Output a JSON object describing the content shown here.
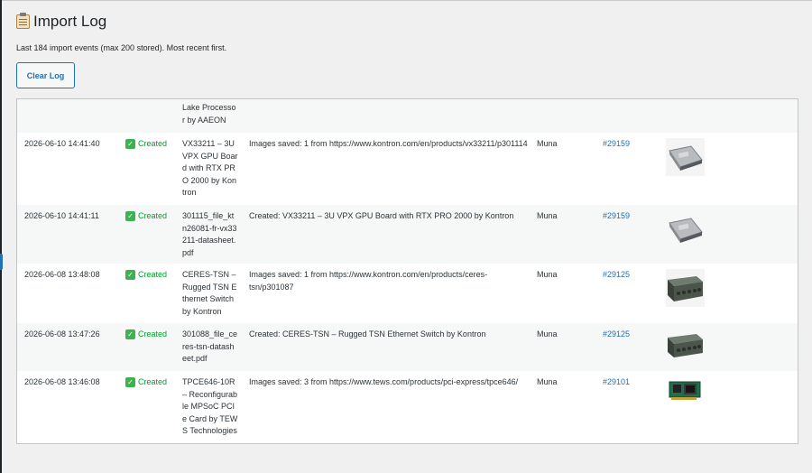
{
  "page": {
    "title": "Import Log",
    "description": "Last 184 import events (max 200 stored). Most recent first.",
    "clear_label": "Clear Log"
  },
  "rows": [
    {
      "date": "",
      "status": "",
      "file": "Lake Processor by AAEON",
      "message": "",
      "user": "",
      "post": "",
      "thumb": ""
    },
    {
      "date": "2026-06-10 14:41:40",
      "status": "Created",
      "file": "VX33211 – 3U VPX GPU Board with RTX PRO 2000 by Kontron",
      "message": "Images saved: 1 from https://www.kontron.com/en/products/vx33211/p301114",
      "user": "Muna",
      "post": "#29159",
      "thumb": "gpu-board-thumbnail-icon"
    },
    {
      "date": "2026-06-10 14:41:11",
      "status": "Created",
      "file": "301115_file_ktn26081-fr-vx33211-datasheet.pdf",
      "message": "Created: VX33211 – 3U VPX GPU Board with RTX PRO 2000 by Kontron",
      "user": "Muna",
      "post": "#29159",
      "thumb": "gpu-board-thumbnail-icon"
    },
    {
      "date": "2026-06-08 13:48:08",
      "status": "Created",
      "file": "CERES-TSN – Rugged TSN Ethernet Switch by Kontron",
      "message": "Images saved: 1 from https://www.kontron.com/en/products/ceres-tsn/p301087",
      "user": "Muna",
      "post": "#29125",
      "thumb": "ethernet-switch-thumbnail-icon"
    },
    {
      "date": "2026-06-08 13:47:26",
      "status": "Created",
      "file": "301088_file_ceres-tsn-datasheet.pdf",
      "message": "Created: CERES-TSN – Rugged TSN Ethernet Switch by Kontron",
      "user": "Muna",
      "post": "#29125",
      "thumb": "ethernet-switch-thumbnail-icon"
    },
    {
      "date": "2026-06-08 13:46:08",
      "status": "Created",
      "file": "TPCE646-10R – Reconfigurable MPSoC PCIe Card by TEWS Technologies",
      "message": "Images saved: 3 from https://www.tews.com/products/pci-express/tpce646/",
      "user": "Muna",
      "post": "#29101",
      "thumb": "pcie-card-thumbnail-icon"
    }
  ],
  "colors": {
    "accent": "#2271b1",
    "success": "#00a32a",
    "background": "#f0f0f1"
  }
}
